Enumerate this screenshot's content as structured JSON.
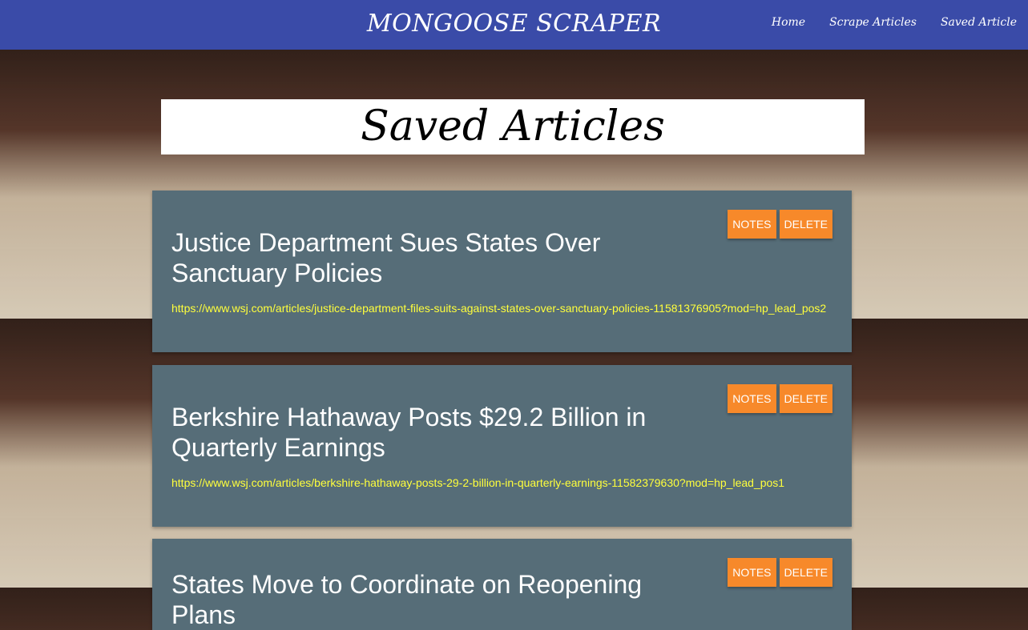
{
  "nav": {
    "brand": "MONGOOSE SCRAPER",
    "links": [
      "Home",
      "Scrape Articles",
      "Saved Article"
    ]
  },
  "page_title": "Saved Articles",
  "articles": [
    {
      "title": "Justice Department Sues States Over Sanctuary Policies",
      "url": "https://www.wsj.com/articles/justice-department-files-suits-against-states-over-sanctuary-policies-11581376905?mod=hp_lead_pos2",
      "notes": "NOTES",
      "delete": "DELETE"
    },
    {
      "title": "Berkshire Hathaway Posts $29.2 Billion in Quarterly Earnings",
      "url": "https://www.wsj.com/articles/berkshire-hathaway-posts-29-2-billion-in-quarterly-earnings-11582379630?mod=hp_lead_pos1",
      "notes": "NOTES",
      "delete": "DELETE"
    },
    {
      "title": "States Move to Coordinate on Reopening Plans",
      "notes": "NOTES",
      "delete": "DELETE"
    }
  ]
}
